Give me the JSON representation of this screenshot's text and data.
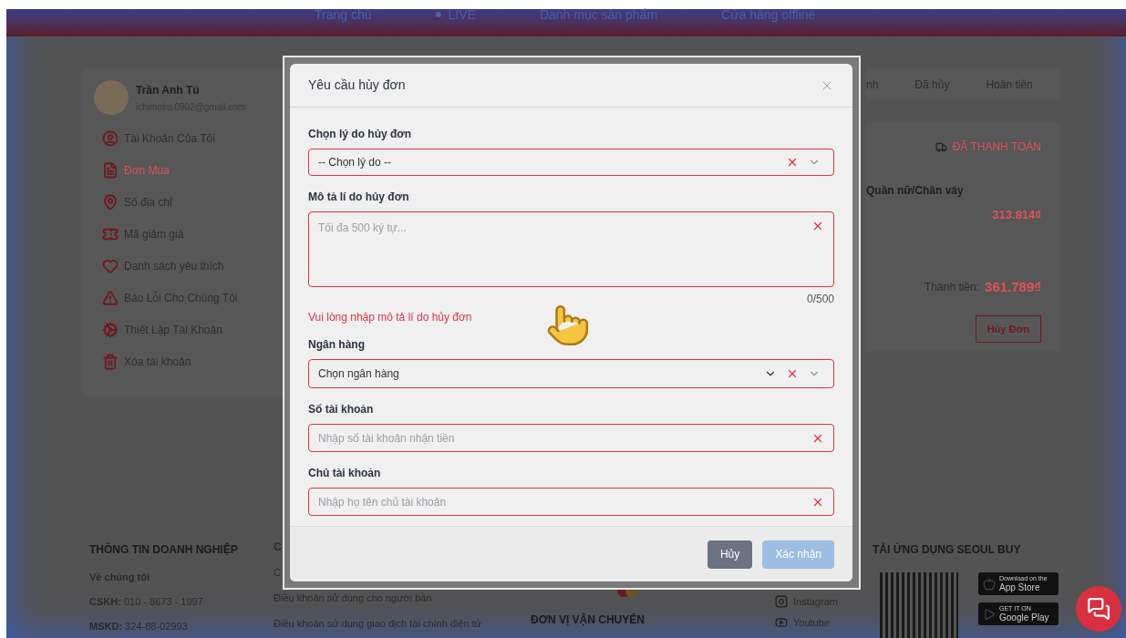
{
  "header_nav": [
    {
      "label": "Trang chủ",
      "kind": "link"
    },
    {
      "label": "LIVE",
      "kind": "live"
    },
    {
      "label": "Danh mục sản phẩm",
      "kind": "link"
    },
    {
      "label": "Cửa hàng offline",
      "kind": "link"
    }
  ],
  "profile": {
    "name": "Trần Anh Tú",
    "email": "ichimoku.0902@gmail.com"
  },
  "sidebar": {
    "items": [
      {
        "label": "Tài Khoản Của Tôi",
        "selected": false
      },
      {
        "label": "Đơn Mua",
        "selected": true
      },
      {
        "label": "Số địa chỉ",
        "selected": false
      },
      {
        "label": "Mã giảm giá",
        "selected": false
      },
      {
        "label": "Danh sách yêu thích",
        "selected": false
      },
      {
        "label": "Báo Lỗi Cho Chúng Tôi",
        "selected": false
      },
      {
        "label": "Thiết Lập Tài Khoản",
        "selected": false
      },
      {
        "label": "Xóa tài khoản",
        "selected": false
      }
    ]
  },
  "order_tabs": [
    {
      "label": "nh",
      "selected": false
    },
    {
      "label": "Đã hủy",
      "selected": false
    },
    {
      "label": "Hoàn tiền",
      "selected": false
    }
  ],
  "order": {
    "status": "ĐÃ THANH TOÁN",
    "product": "Quần nữ/Chân váy",
    "price": "313.814₫",
    "total_label": "Thành tiền:",
    "total": "361.789₫",
    "cancel_button": "Hủy Đơn"
  },
  "modal": {
    "title": "Yêu cầu hủy đơn",
    "fields": [
      {
        "kind": "select",
        "label": "Chọn lý do hủy đơn",
        "value": "-- Chọn lý do --"
      },
      {
        "kind": "textarea",
        "label": "Mô tả lí do hủy đơn",
        "placeholder": "Tối đa 500 ký tự...",
        "counter": "0/500",
        "error": "Vui lòng nhập mô tả lí do hủy đơn"
      },
      {
        "kind": "bank_select",
        "label": "Ngân hàng",
        "value": "Chọn ngân hàng"
      },
      {
        "kind": "input",
        "label": "Số tài khoản",
        "placeholder": "Nhập số tài khoản nhận tiền"
      },
      {
        "kind": "input",
        "label": "Chủ tài khoản",
        "placeholder": "Nhập họ tên chủ tài khoản"
      }
    ],
    "buttons": [
      {
        "label": "Hủy",
        "kind": "secondary",
        "disabled": false
      },
      {
        "label": "Xác nhận",
        "kind": "primary",
        "disabled": true
      }
    ]
  },
  "footer": {
    "company": {
      "title": "THÔNG TIN DOANH NGHIỆP",
      "lines": [
        "**Về chúng tôi**",
        "**CSKH:** 010 - 8673 - 1997",
        "**MSKD:** 324-88-02993"
      ]
    },
    "column_2": {
      "lines": [
        "C",
        "C",
        "Điều khoản sử dụng cho người bán",
        "Điều khoản sử dụng giao dịch tài chính điện tử"
      ]
    },
    "shipping": {
      "title": "ĐƠN VỊ VẬN CHUYỂN"
    },
    "social": [
      {
        "label": "Instagram"
      },
      {
        "label": "Youtube"
      }
    ],
    "app": {
      "title": "TẢI ỨNG DỤNG SEOUL BUY",
      "badges": [
        {
          "caption": "Download on the",
          "label": "App Store"
        },
        {
          "caption": "GET IT ON",
          "label": "Google Play"
        }
      ]
    }
  }
}
